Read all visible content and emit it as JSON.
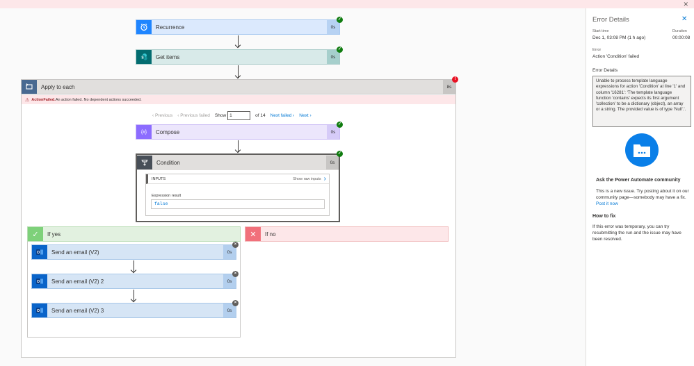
{
  "window": {
    "close_glyph": "✕"
  },
  "flow": {
    "recurrence": {
      "title": "Recurrence",
      "duration": "0s",
      "icon": "alarm-clock-icon",
      "color": "#1f85ff"
    },
    "get_items": {
      "title": "Get items",
      "duration": "0s",
      "icon": "sharepoint-icon",
      "color": "#036c70"
    },
    "apply_each": {
      "title": "Apply to each",
      "duration": "8s",
      "icon": "loop-icon",
      "color": "#486991"
    },
    "error_banner": {
      "bold": "ActionFailed.",
      "text": " An action failed. No dependent actions succeeded."
    },
    "pager": {
      "previous": "‹ Previous",
      "previous_failed": "‹ Previous failed",
      "show": "Show",
      "value": "1",
      "of": "of 14",
      "next_failed": "Next failed ›",
      "next": "Next ›"
    },
    "compose": {
      "title": "Compose",
      "duration": "0s",
      "icon": "compose-icon",
      "color": "#8c6cff"
    },
    "condition": {
      "title": "Condition",
      "duration": "0s",
      "icon": "condition-icon",
      "color": "#484f58",
      "inputs_label": "INPUTS",
      "show_raw": "Show raw inputs",
      "expr_label": "Expression result",
      "expr_value": "false"
    },
    "if_yes": {
      "title": "If yes",
      "icon": "check-icon"
    },
    "if_no": {
      "title": "If no",
      "icon": "x-icon"
    },
    "emails": [
      {
        "title": "Send an email (V2)",
        "duration": "0s",
        "icon": "outlook-icon"
      },
      {
        "title": "Send an email (V2) 2",
        "duration": "0s",
        "icon": "outlook-icon"
      },
      {
        "title": "Send an email (V2) 3",
        "duration": "0s",
        "icon": "outlook-icon"
      }
    ]
  },
  "panel": {
    "title": "Error Details",
    "start_label": "Start time",
    "start_value": "Dec 1, 03:08 PM (1 h ago)",
    "duration_label": "Duration",
    "duration_value": "00:00:08",
    "error_label": "Error",
    "error_value": "Action 'Condition' failed",
    "details_label": "Error Details",
    "details_text": "Unable to process template language expressions for action 'Condition' at line '1' and column '16281': 'The template language function 'contains' expects its first argument 'collection' to be a dictionary (object), an array or a string. The provided value is of type 'Null'.'.",
    "community_title": "Ask the Power Automate community",
    "community_text": "This is a new issue. Try posting about it on our community page—somebody may have a fix. ",
    "post_link": "Post it now",
    "howto_title": "How to fix",
    "howto_text": "If this error was temporary, you can try resubmitting the run and the issue may have been resolved."
  },
  "colors": {
    "success": "#107c10",
    "failed": "#e81123",
    "accent": "#0078d4"
  }
}
